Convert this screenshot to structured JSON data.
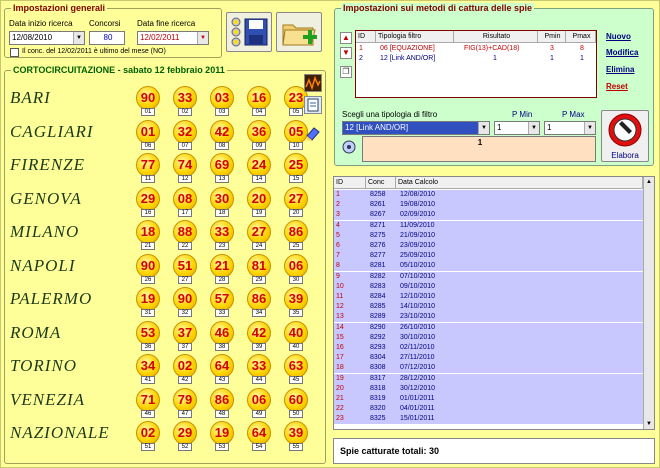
{
  "general": {
    "title": "Impostazioni generali",
    "start_label": "Data inizio ricerca",
    "start_value": "12/08/2010",
    "draws_label": "Concorsi",
    "draws_value": "80",
    "end_label": "Data fine ricerca",
    "end_value": "12/02/2011",
    "checkbox_label": "Il conc. del 12/02/2011 è ultimo del mese (NO)"
  },
  "corto": {
    "title": "CORTOCIRCUITAZIONE - sabato 12 febbraio 2011",
    "wheels": [
      {
        "name": "BARI",
        "nums": [
          "90",
          "33",
          "03",
          "16",
          "23"
        ],
        "sub": [
          "01",
          "02",
          "03",
          "04",
          "05"
        ]
      },
      {
        "name": "CAGLIARI",
        "nums": [
          "01",
          "32",
          "42",
          "36",
          "05"
        ],
        "sub": [
          "06",
          "07",
          "08",
          "09",
          "10"
        ]
      },
      {
        "name": "FIRENZE",
        "nums": [
          "77",
          "74",
          "69",
          "24",
          "25"
        ],
        "sub": [
          "11",
          "12",
          "13",
          "14",
          "15"
        ]
      },
      {
        "name": "GENOVA",
        "nums": [
          "29",
          "08",
          "30",
          "20",
          "27"
        ],
        "sub": [
          "16",
          "17",
          "18",
          "19",
          "20"
        ]
      },
      {
        "name": "MILANO",
        "nums": [
          "18",
          "88",
          "33",
          "27",
          "86"
        ],
        "sub": [
          "21",
          "22",
          "23",
          "24",
          "25"
        ]
      },
      {
        "name": "NAPOLI",
        "nums": [
          "90",
          "51",
          "21",
          "81",
          "06"
        ],
        "sub": [
          "26",
          "27",
          "28",
          "29",
          "30"
        ]
      },
      {
        "name": "PALERMO",
        "nums": [
          "19",
          "90",
          "57",
          "86",
          "39"
        ],
        "sub": [
          "31",
          "32",
          "33",
          "34",
          "35"
        ]
      },
      {
        "name": "ROMA",
        "nums": [
          "53",
          "37",
          "46",
          "42",
          "40"
        ],
        "sub": [
          "36",
          "37",
          "38",
          "39",
          "40"
        ]
      },
      {
        "name": "TORINO",
        "nums": [
          "34",
          "02",
          "64",
          "33",
          "63"
        ],
        "sub": [
          "41",
          "42",
          "43",
          "44",
          "45"
        ]
      },
      {
        "name": "VENEZIA",
        "nums": [
          "71",
          "79",
          "86",
          "06",
          "60"
        ],
        "sub": [
          "46",
          "47",
          "48",
          "49",
          "50"
        ]
      },
      {
        "name": "NAZIONALE",
        "nums": [
          "02",
          "29",
          "19",
          "64",
          "39"
        ],
        "sub": [
          "51",
          "52",
          "53",
          "54",
          "55"
        ]
      }
    ]
  },
  "methods": {
    "title": "Impostazioni sui metodi di cattura delle spie",
    "headers": [
      "ID",
      "Tipologia filtro",
      "Risultato",
      "Pmin",
      "Pmax"
    ],
    "rows": [
      [
        "1",
        "06 [EQUAZIONE]",
        "FIG(13)+CAD(18)",
        "3",
        "8"
      ],
      [
        "2",
        "12 [Link AND/OR]",
        "1",
        "1",
        "1"
      ]
    ],
    "links": [
      "Nuovo",
      "Modifica",
      "Elimina",
      "Reset"
    ],
    "choose_label": "Scegli una tipologia di filtro",
    "choose_value": "12 [Link AND/OR]",
    "pmin_label": "P Min",
    "pmin_value": "1",
    "pmax_label": "P Max",
    "pmax_value": "1",
    "result_value": "1",
    "elabora_label": "Elabora"
  },
  "results": {
    "headers": [
      "ID",
      "Conc",
      "Data Calcolo"
    ],
    "rows": [
      [
        "1",
        "8258",
        "12/08/2010"
      ],
      [
        "2",
        "8261",
        "19/08/2010"
      ],
      [
        "3",
        "8267",
        "02/09/2010"
      ],
      [
        "4",
        "8271",
        "11/09/2010"
      ],
      [
        "5",
        "8275",
        "21/09/2010"
      ],
      [
        "6",
        "8276",
        "23/09/2010"
      ],
      [
        "7",
        "8277",
        "25/09/2010"
      ],
      [
        "8",
        "8281",
        "05/10/2010"
      ],
      [
        "9",
        "8282",
        "07/10/2010"
      ],
      [
        "10",
        "8283",
        "09/10/2010"
      ],
      [
        "11",
        "8284",
        "12/10/2010"
      ],
      [
        "12",
        "8285",
        "14/10/2010"
      ],
      [
        "13",
        "8289",
        "23/10/2010"
      ],
      [
        "14",
        "8290",
        "26/10/2010"
      ],
      [
        "15",
        "8292",
        "30/10/2010"
      ],
      [
        "16",
        "8293",
        "02/11/2010"
      ],
      [
        "17",
        "8304",
        "27/11/2010"
      ],
      [
        "18",
        "8308",
        "07/12/2010"
      ],
      [
        "19",
        "8317",
        "28/12/2010"
      ],
      [
        "20",
        "8318",
        "30/12/2010"
      ],
      [
        "21",
        "8319",
        "01/01/2011"
      ],
      [
        "22",
        "8320",
        "04/01/2011"
      ],
      [
        "23",
        "8325",
        "15/01/2011"
      ]
    ],
    "total_label": "Spie catturate totali: 30"
  }
}
